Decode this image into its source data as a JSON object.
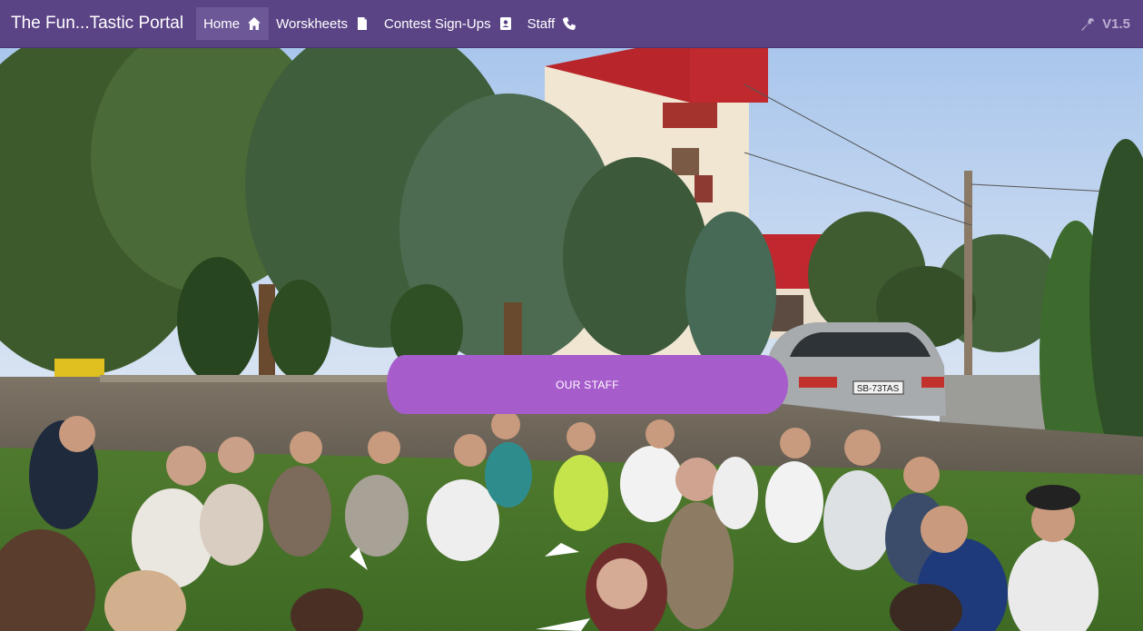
{
  "nav": {
    "brand": "The Fun...Tastic Portal",
    "items": [
      {
        "label": "Home",
        "icon": "home-icon",
        "active": true
      },
      {
        "label": "Worskheets",
        "icon": "file-icon",
        "active": false
      },
      {
        "label": "Contest Sign-Ups",
        "icon": "id-card-icon",
        "active": false
      },
      {
        "label": "Staff",
        "icon": "phone-icon",
        "active": false
      }
    ],
    "version": "V1.5",
    "version_icon": "wrench-icon"
  },
  "hero": {
    "staff_button_label": "OUR STAFF",
    "car_plate": "SB-73TAS"
  },
  "colors": {
    "navbar": "#5b4486",
    "active_item": "#6c5797",
    "staff_button": "#a75ccc"
  }
}
